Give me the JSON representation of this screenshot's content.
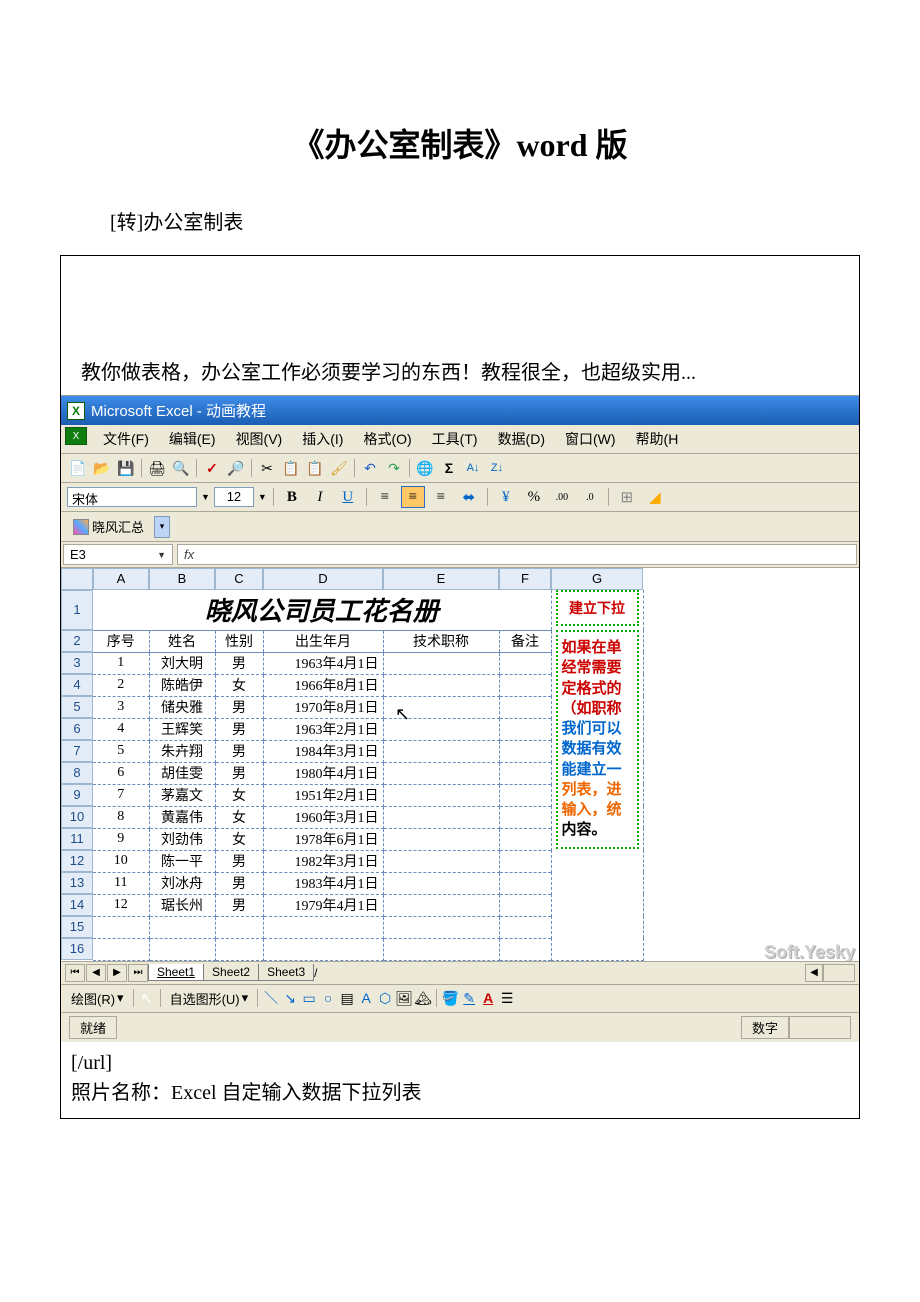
{
  "doc": {
    "title": "《办公室制表》word 版",
    "subtitle": "[转]办公室制表",
    "desc": "教你做表格，办公室工作必须要学习的东西！教程很全，也超级实用...",
    "post_url_tag": "[/url]",
    "post_caption": "照片名称：Excel 自定输入数据下拉列表"
  },
  "excel": {
    "title_prefix": "Microsoft Excel - ",
    "title_doc": "动画教程",
    "menus": [
      "文件(F)",
      "编辑(E)",
      "视图(V)",
      "插入(I)",
      "格式(O)",
      "工具(T)",
      "数据(D)",
      "窗口(W)",
      "帮助(H"
    ],
    "font_name": "宋体",
    "font_size": "12",
    "custom_btn": "晓风汇总",
    "namebox": "E3",
    "fx_label": "fx",
    "col_headers": [
      "A",
      "B",
      "C",
      "D",
      "E",
      "F",
      "G"
    ],
    "row_headers": [
      "1",
      "2",
      "3",
      "4",
      "5",
      "6",
      "7",
      "8",
      "9",
      "10",
      "11",
      "12",
      "13",
      "14",
      "15",
      "16"
    ],
    "big_title": "晓风公司员工花名册",
    "headers": [
      "序号",
      "姓名",
      "性别",
      "出生年月",
      "技术职称",
      "备注"
    ],
    "rows": [
      [
        "1",
        "刘大明",
        "男",
        "1963年4月1日",
        "",
        ""
      ],
      [
        "2",
        "陈皓伊",
        "女",
        "1966年8月1日",
        "",
        ""
      ],
      [
        "3",
        "储央雅",
        "男",
        "1970年8月1日",
        "",
        ""
      ],
      [
        "4",
        "王辉笑",
        "男",
        "1963年2月1日",
        "",
        ""
      ],
      [
        "5",
        "朱卉翔",
        "男",
        "1984年3月1日",
        "",
        ""
      ],
      [
        "6",
        "胡佳雯",
        "男",
        "1980年4月1日",
        "",
        ""
      ],
      [
        "7",
        "茅嘉文",
        "女",
        "1951年2月1日",
        "",
        ""
      ],
      [
        "8",
        "黄嘉伟",
        "女",
        "1960年3月1日",
        "",
        ""
      ],
      [
        "9",
        "刘劲伟",
        "女",
        "1978年6月1日",
        "",
        ""
      ],
      [
        "10",
        "陈一平",
        "男",
        "1982年3月1日",
        "",
        ""
      ],
      [
        "11",
        "刘冰舟",
        "男",
        "1983年4月1日",
        "",
        ""
      ],
      [
        "12",
        "琚长州",
        "男",
        "1979年4月1日",
        "",
        ""
      ]
    ],
    "side_title": "建立下拉",
    "side_lines": [
      "如果在单",
      "经常需要",
      "定格式的",
      "（如职称",
      "我们可以",
      "数据有效",
      "能建立一",
      "列表，进",
      "输入，统",
      "内容。"
    ],
    "sheets": [
      "Sheet1",
      "Sheet2",
      "Sheet3"
    ],
    "draw_label": "绘图(R)",
    "autoshape": "自选图形(U)",
    "status_ready": "就绪",
    "status_num": "数字",
    "watermark": "Soft.Yesky"
  }
}
